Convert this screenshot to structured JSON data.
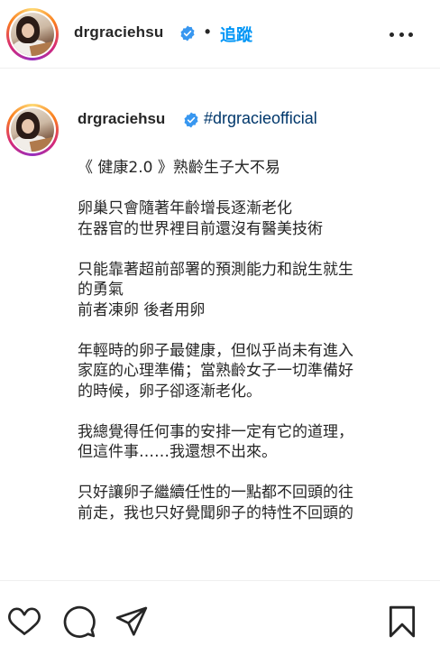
{
  "header": {
    "username": "drgraciehsu",
    "separator": "•",
    "follow_label": "追蹤"
  },
  "caption": {
    "username": "drgraciehsu",
    "hashtag": "#drgracieofficial",
    "lines": [
      "《 健康2.0 》熟齡生子大不易",
      "",
      "卵巢只會隨著年齡增長逐漸老化",
      "在器官的世界裡目前還沒有醫美技術",
      "",
      "只能靠著超前部署的預測能力和說生就生",
      "的勇氣",
      "前者凍卵 後者用卵",
      "",
      "年輕時的卵子最健康，但似乎尚未有進入",
      "家庭的心理準備；當熟齡女子一切準備好",
      "的時候，卵子卻逐漸老化。",
      "",
      "我總覺得任何事的安排一定有它的道理，",
      "但這件事……我還想不出來。",
      "",
      "只好讓卵子繼續任性的一點都不回頭的往",
      "前走，我也只好覺聞卵子的特性不回頭的"
    ]
  },
  "icons": {
    "verified": "verified-badge-icon",
    "more": "more-options-icon",
    "like": "heart-icon",
    "comment": "comment-bubble-icon",
    "share": "paper-plane-icon",
    "save": "bookmark-icon"
  },
  "colors": {
    "follow": "#0095f6",
    "hashtag": "#00376b",
    "verified": "#3897f0",
    "text": "#262626"
  }
}
